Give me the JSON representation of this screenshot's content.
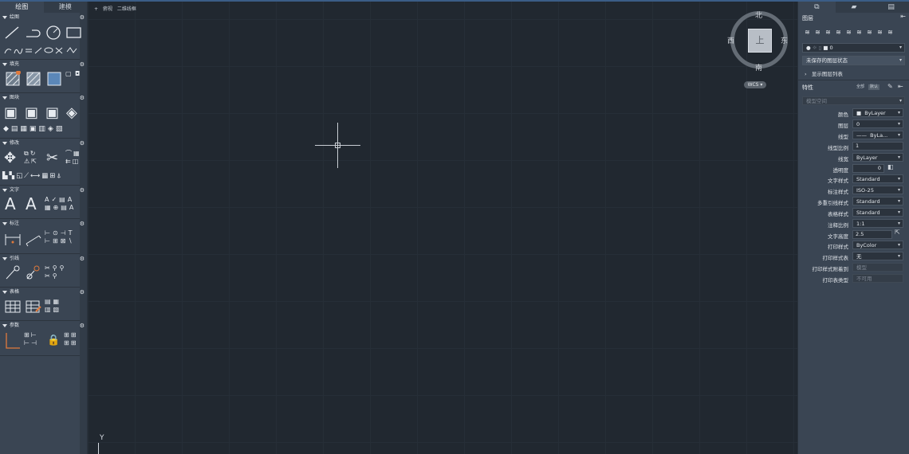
{
  "left_panel": {
    "tabs": [
      "绘图",
      "建模"
    ],
    "sections": [
      {
        "title": "绘图",
        "icons_big": [
          "line-icon",
          "polyline-icon",
          "circle-icon",
          "rectangle-icon"
        ],
        "icons_small": [
          "arc-icon",
          "spline-icon",
          "construction-line-icon",
          "ray-icon",
          "ellipse-icon",
          "multiline-icon",
          "revcloud-icon"
        ]
      },
      {
        "title": "填充",
        "icons_big": [
          "hatch-icon",
          "gradient-icon",
          "boundary-icon"
        ],
        "icons_small": [
          "region-icon",
          "wipeout-icon"
        ]
      },
      {
        "title": "图块",
        "icons_big": [
          "insert-block-icon",
          "create-block-icon",
          "edit-block-icon",
          "attribute-icon"
        ],
        "icons_small": [
          "block-tag-icon",
          "block-palette-icon",
          "write-block-icon",
          "define-attribute-icon",
          "manage-attributes-icon",
          "block-editor-icon"
        ]
      },
      {
        "title": "修改",
        "icons_big": [
          "move-icon",
          "trim-icon"
        ],
        "icons_small": [
          "copy-icon",
          "rotate-icon",
          "mirror-icon",
          "scale-icon",
          "stretch-icon",
          "fillet-icon",
          "array-icon",
          "offset-icon",
          "explode-icon",
          "erase-icon",
          "extend-icon",
          "break-icon",
          "join-icon",
          "chamfer-icon",
          "align-icon",
          "draworder-icon"
        ]
      },
      {
        "title": "文字",
        "icons_big": [
          "multiline-text-icon",
          "single-line-text-icon"
        ],
        "icons_small": [
          "text-style-icon",
          "spell-check-icon",
          "field-icon",
          "find-replace-icon",
          "text-align-icon",
          "scale-text-icon"
        ]
      },
      {
        "title": "标注",
        "icons_big": [
          "linear-dimension-icon",
          "aligned-dimension-icon"
        ],
        "icons_small": [
          "baseline-dimension-icon",
          "radius-dimension-icon",
          "continue-dimension-icon",
          "angular-dimension-icon",
          "ordinate-dimension-icon",
          "arc-length-dimension-icon"
        ]
      },
      {
        "title": "引线",
        "icons_big": [
          "leader-icon",
          "multileader-icon"
        ],
        "icons_small": [
          "add-leader-icon",
          "remove-leader-icon",
          "align-leader-icon",
          "collect-leader-icon"
        ]
      },
      {
        "title": "表格",
        "icons_big": [
          "table-icon",
          "table-style-icon"
        ],
        "icons_small": [
          "data-link-icon",
          "extract-data-icon"
        ]
      },
      {
        "title": "参数",
        "icons_big": [
          "constraint-icon",
          "auto-constrain-icon",
          "lock-icon"
        ],
        "icons_small": [
          "geometric-constraint-icon",
          "dimensional-constraint-icon",
          "show-constraints-icon",
          "delete-constraints-icon",
          "parameters-manager-icon",
          "constraint-settings-icon"
        ]
      }
    ]
  },
  "viewport": {
    "controls": [
      "+",
      "俯视",
      "二维线框"
    ]
  },
  "viewcube": {
    "face": "上",
    "north": "北",
    "south": "南",
    "east": "东",
    "west": "西",
    "wcs": "WCS"
  },
  "ucs": {
    "y_label": "Y"
  },
  "right_panel": {
    "tabs": [
      "properties-tab-icon",
      "sheet-set-icon",
      "layout-icon"
    ],
    "layers": {
      "title": "图层",
      "current_layer": "0",
      "layer_state": "未保存的图层状态",
      "show_list": "显示图层列表"
    },
    "properties": {
      "title": "特性",
      "buttons": [
        "全部",
        "默认"
      ],
      "space": "模型空间",
      "rows": [
        {
          "label": "颜色",
          "value": "ByLayer",
          "type": "color"
        },
        {
          "label": "图层",
          "value": "0",
          "type": "dropdown"
        },
        {
          "label": "线型",
          "value": "ByLa...",
          "type": "linetype"
        },
        {
          "label": "线型比例",
          "value": "1",
          "type": "input"
        },
        {
          "label": "线宽",
          "value": "ByLayer",
          "type": "dropdown"
        },
        {
          "label": "透明度",
          "value": "0",
          "type": "transparency"
        },
        {
          "label": "文字样式",
          "value": "Standard",
          "type": "dropdown"
        },
        {
          "label": "标注样式",
          "value": "ISO-25",
          "type": "dropdown"
        },
        {
          "label": "多重引线样式",
          "value": "Standard",
          "type": "dropdown"
        },
        {
          "label": "表格样式",
          "value": "Standard",
          "type": "dropdown"
        },
        {
          "label": "注释比例",
          "value": "1:1",
          "type": "dropdown"
        },
        {
          "label": "文字高度",
          "value": "2.5",
          "type": "height"
        },
        {
          "label": "打印样式",
          "value": "ByColor",
          "type": "dropdown"
        },
        {
          "label": "打印样式表",
          "value": "无",
          "type": "dropdown"
        },
        {
          "label": "打印样式附着到",
          "value": "模型",
          "type": "disabled"
        },
        {
          "label": "打印表类型",
          "value": "不可用",
          "type": "disabled"
        }
      ]
    }
  }
}
